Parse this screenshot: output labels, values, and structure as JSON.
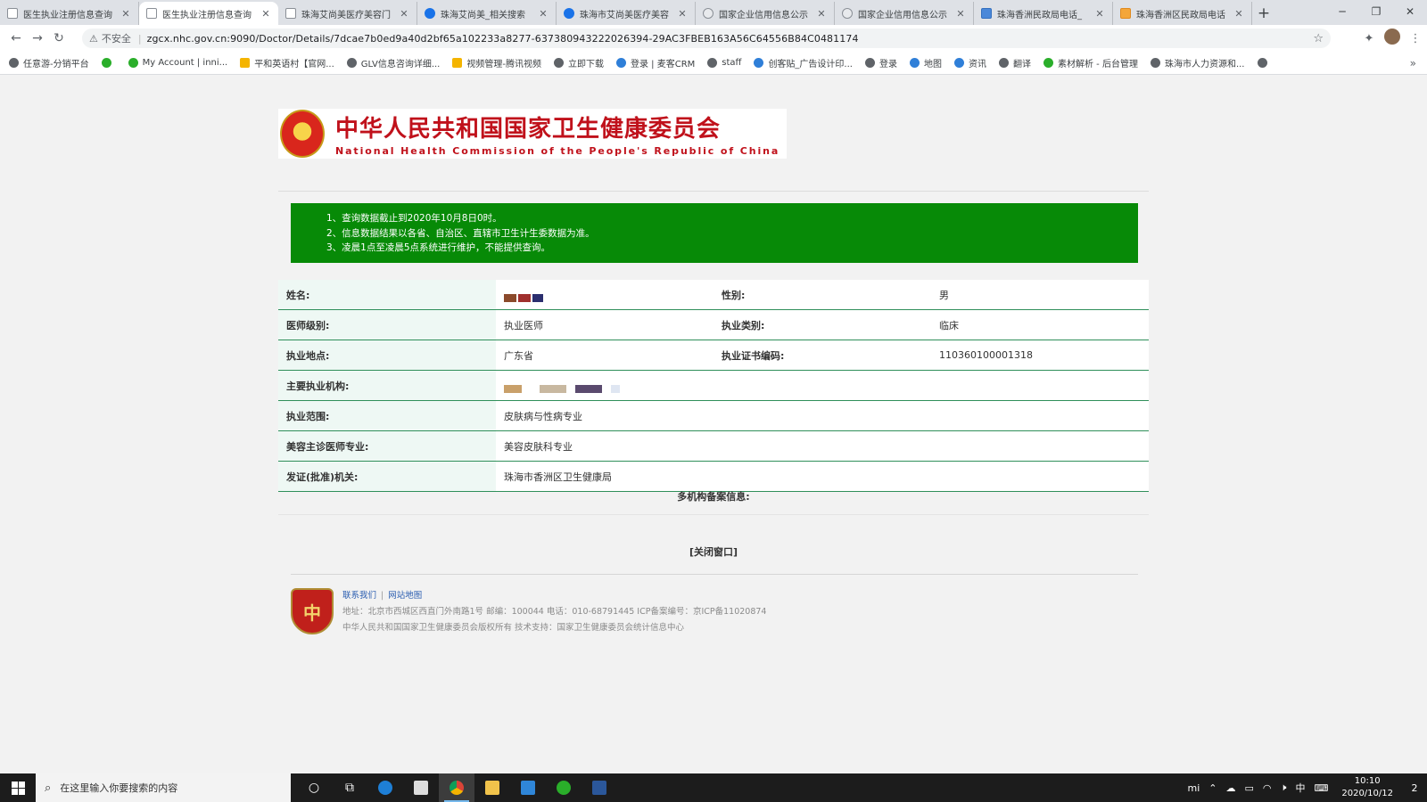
{
  "browser": {
    "tabs": [
      {
        "label": "医生执业注册信息查询",
        "icon": "doc-icon",
        "active": false
      },
      {
        "label": "医生执业注册信息查询",
        "icon": "doc-icon",
        "active": true
      },
      {
        "label": "珠海艾尚美医疗美容门",
        "icon": "doc-icon",
        "active": false
      },
      {
        "label": "珠海艾尚美_相关搜索",
        "icon": "chrome-search-icon",
        "active": false
      },
      {
        "label": "珠海市艾尚美医疗美容",
        "icon": "chrome-search-icon",
        "active": false
      },
      {
        "label": "国家企业信用信息公示",
        "icon": "globe-icon",
        "active": false
      },
      {
        "label": "国家企业信用信息公示",
        "icon": "globe-icon",
        "active": false
      },
      {
        "label": "珠海香洲民政局电话_",
        "icon": "search-engine-icon",
        "active": false
      },
      {
        "label": "珠海香洲区民政局电话",
        "icon": "orange-site-icon",
        "active": false
      }
    ],
    "address": {
      "security_label": "不安全",
      "url": "zgcx.nhc.gov.cn:9090/Doctor/Details/7dcae7b0ed9a40d2bf65a102233a8277-637380943222026394-29AC3FBEB163A56C64556B84C0481174"
    },
    "bookmarks": [
      {
        "label": "任意游-分销平台",
        "icon": "globe-icon"
      },
      {
        "label": "",
        "icon": "wechat-icon"
      },
      {
        "label": "My Account | inni...",
        "icon": "plant-icon"
      },
      {
        "label": "平和英语村【官网...",
        "icon": "site-icon"
      },
      {
        "label": "GLV信息咨询详细...",
        "icon": "globe-icon"
      },
      {
        "label": "视频管理-腾讯视频",
        "icon": "video-icon"
      },
      {
        "label": "立即下载",
        "icon": "globe-icon"
      },
      {
        "label": "登录 | 麦客CRM",
        "icon": "crm-icon"
      },
      {
        "label": "staff",
        "icon": "globe-icon"
      },
      {
        "label": "创客贴_广告设计印...",
        "icon": "site-icon"
      },
      {
        "label": "登录",
        "icon": "globe-icon"
      },
      {
        "label": "地图",
        "icon": "map-pin-icon"
      },
      {
        "label": "资讯",
        "icon": "news-icon"
      },
      {
        "label": "翻译",
        "icon": "globe-icon"
      },
      {
        "label": "素材解析 - 后台管理",
        "icon": "v-icon"
      },
      {
        "label": "珠海市人力资源和...",
        "icon": "globe-icon"
      },
      {
        "label": "",
        "icon": "globe-icon"
      }
    ]
  },
  "header": {
    "title_cn": "中华人民共和国国家卫生健康委员会",
    "title_en": "National Health Commission of the People's Republic of China"
  },
  "notice": {
    "lines": [
      "1、查询数据截止到2020年10月8日0时。",
      "2、信息数据结果以各省、自治区、直辖市卫生计生委数据为准。",
      "3、凌晨1点至凌晨5点系统进行维护，不能提供查询。"
    ]
  },
  "doctor": {
    "name_label": "姓名:",
    "gender_label": "性别:",
    "gender_value": "男",
    "level_label": "医师级别:",
    "level_value": "执业医师",
    "category_label": "执业类别:",
    "category_value": "临床",
    "location_label": "执业地点:",
    "location_value": "广东省",
    "cert_label": "执业证书编码:",
    "cert_value": "110360100001318",
    "institution_label": "主要执业机构:",
    "scope_label": "执业范围:",
    "scope_value": "皮肤病与性病专业",
    "cosmetic_label": "美容主诊医师专业:",
    "cosmetic_value": "美容皮肤科专业",
    "issuer_label": "发证(批准)机关:",
    "issuer_value": "珠海市香洲区卫生健康局"
  },
  "multi_record_label": "多机构备案信息:",
  "close_window_label": "[关闭窗口]",
  "footer": {
    "contact_link": "联系我们",
    "sitemap_link": "网站地图",
    "address_line": "地址：北京市西城区西直门外南路1号   邮编：100044   电话：010-68791445   ICP备案编号：京ICP备11020874",
    "copyright_line": "中华人民共和国国家卫生健康委员会版权所有   技术支持：国家卫生健康委员会统计信息中心",
    "logo_label": "党政机关"
  },
  "taskbar": {
    "search_placeholder": "在这里输入你要搜索的内容",
    "ime_label": "中",
    "time": "10:10",
    "date": "2020/10/12",
    "notification_count": "2"
  },
  "colors": {
    "notice_bg": "#078a07",
    "brand_red": "#c0111b",
    "row_border": "#2f8f5a"
  }
}
